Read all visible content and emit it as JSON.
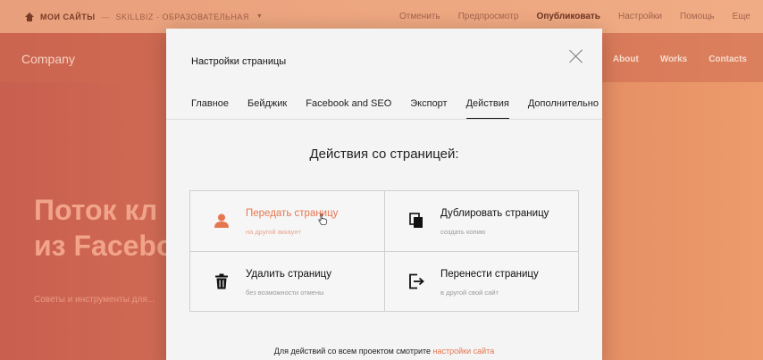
{
  "topbar": {
    "breadcrumb_sites": "МОИ САЙТЫ",
    "breadcrumb_project": "SKILLBIZ - ОБРАЗОВАТЕЛЬНАЯ",
    "actions": [
      "Отменить",
      "Предпросмотр",
      "Опубликовать",
      "Настройки",
      "Помощь",
      "Еще"
    ]
  },
  "site": {
    "logo": "Company",
    "nav": [
      "About",
      "Works",
      "Contacts"
    ],
    "hero_line1": "Поток кл",
    "hero_line2": "из Facebo",
    "hero_sub": "Советы и инструменты для..."
  },
  "modal": {
    "title": "Настройки страницы",
    "tabs": [
      {
        "label": "Главное",
        "active": false
      },
      {
        "label": "Бейджик",
        "active": false
      },
      {
        "label": "Facebook and SEO",
        "active": false
      },
      {
        "label": "Экспорт",
        "active": false
      },
      {
        "label": "Действия",
        "active": true
      },
      {
        "label": "Дополнительно",
        "active": false
      }
    ],
    "section_title": "Действия со страницей:",
    "actions": [
      {
        "name": "Передать страницу",
        "desc": "на другой аккаунт",
        "icon": "user-icon",
        "highlight": true
      },
      {
        "name": "Дублировать страницу",
        "desc": "создать копию",
        "icon": "copy-icon",
        "highlight": false
      },
      {
        "name": "Удалить страницу",
        "desc": "без возможности отмены",
        "icon": "trash-icon",
        "highlight": false
      },
      {
        "name": "Перенести страницу",
        "desc": "в другой свой сайт",
        "icon": "move-icon",
        "highlight": false
      }
    ],
    "footer_text": "Для действий со всем проектом смотрите",
    "footer_link": "настройки сайта"
  },
  "colors": {
    "accent": "#e5764f",
    "modal_bg": "#f4f4f4",
    "page_bg": "#d9765f"
  }
}
